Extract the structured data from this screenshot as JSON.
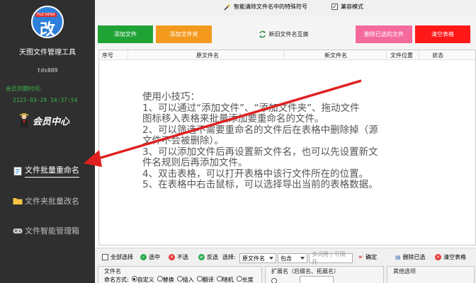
{
  "sidebar": {
    "logo_badge": "FILE RENA",
    "logo_char": "改",
    "app_name": "天图文件管理工具",
    "user_id": "tds009",
    "expire_label": "会员到期时间:",
    "expire_time": "2123-03-29 14:37:54",
    "vip_label": "会员中心",
    "nav": [
      {
        "label": "文件批量重命名",
        "icon": "document-icon",
        "active": true
      },
      {
        "label": "文件夹批量改名",
        "icon": "folder-icon",
        "active": false
      },
      {
        "label": "文件智能管理箱",
        "icon": "gamepad-icon",
        "active": false
      }
    ]
  },
  "topbar": {
    "special_label": "智能清除文件名中的特殊符号",
    "compat_label": "兼容模式",
    "compat_checked": true
  },
  "toolbar": {
    "add_file": "添加文件",
    "add_folder": "添加文件夹",
    "swap": "新旧文件名互换",
    "delete_selected": "删除已选的文件",
    "clear_table": "清空表格"
  },
  "table": {
    "columns": [
      "序号",
      "原文件名",
      "新文件名",
      "文件位置",
      "状态"
    ]
  },
  "tips": [
    "使用小技巧：",
    "1、可以通过“添加文件”、“添加文件夹”、拖动文件",
    "图标移入表格来批量添加要重命名的文件。",
    "2、可以筛选不需要重命名的文件后在表格中删除掉（源",
    "文件不会被删除）。",
    "3、可以添加文件后再设置新文件名，也可以先设置新文",
    "件名规则后再添加文件。",
    "4、双击表格，可以打开表格中该行文件所在的位置。",
    "5、在表格中右击鼠标，可以选择导出当前的表格数据。"
  ],
  "bottombar": {
    "select_all": "全部选择",
    "select": "选中",
    "deselect": "不选",
    "invert": "反选",
    "select_label": "选择:",
    "field_value": "原文件名",
    "match_value": "包含",
    "keyword_placeholder": "多词用 | 号隔开",
    "confirm": "确定",
    "delete_selected": "删除已选",
    "clear_table": "清空表格"
  },
  "options": {
    "filename_title": "文件名",
    "mode_label": "命名方式:",
    "modes": [
      {
        "label": "自定义",
        "selected": true
      },
      {
        "label": "替换",
        "selected": false
      },
      {
        "label": "插入",
        "selected": false
      },
      {
        "label": "翻译",
        "selected": false
      },
      {
        "label": "随机",
        "selected": false
      },
      {
        "label": "长度",
        "selected": false
      }
    ],
    "ext_title": "扩展名（后缀名、拓展名）",
    "other_title": "其他选项"
  },
  "colors": {
    "sidebar_bg": "#2f2f2f",
    "add_file": "#1fa335",
    "add_folder": "#f39a1e",
    "delete_selected": "#f46a9d",
    "clear_table": "#ff1818",
    "arrow": "#e02020",
    "expire_green": "#3ab54a"
  }
}
